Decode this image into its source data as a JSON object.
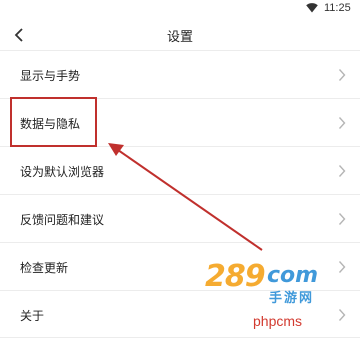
{
  "status": {
    "time": "11:25",
    "wifi_icon": "wifi-icon"
  },
  "header": {
    "title": "设置",
    "back_icon": "chevron-left-icon"
  },
  "settings": {
    "items": [
      {
        "label": "显示与手势"
      },
      {
        "label": "数据与隐私"
      },
      {
        "label": "设为默认浏览器"
      },
      {
        "label": "反馈问题和建议"
      },
      {
        "label": "检查更新"
      },
      {
        "label": "关于"
      }
    ]
  },
  "annotation": {
    "color": "#c0302d"
  },
  "watermark": {
    "logo_number": "289",
    "logo_suffix": "com",
    "logo_cn": "手游网",
    "brand": "phpcms"
  }
}
